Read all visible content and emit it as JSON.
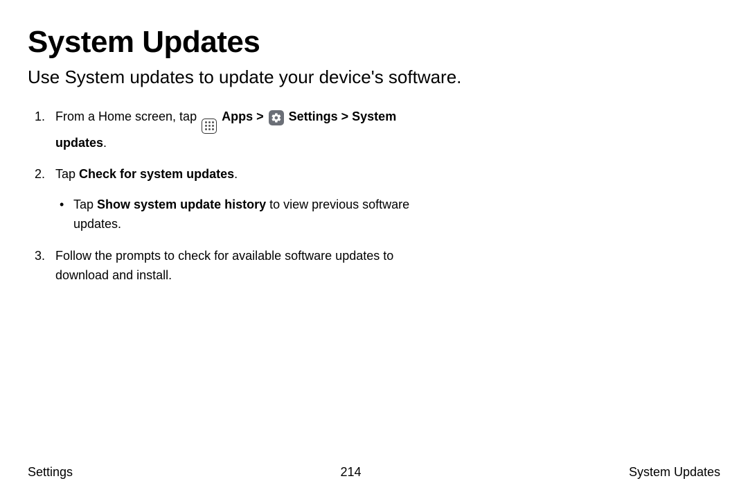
{
  "title": "System Updates",
  "subtitle": "Use System updates to update your device's software.",
  "steps": {
    "s1": {
      "part1": "From a Home screen, tap ",
      "apps": "Apps",
      "sep1": " > ",
      "settings": "Settings",
      "sep2": " > ",
      "sysupdates": "System updates",
      "end": "."
    },
    "s2": {
      "part1": "Tap ",
      "bold": "Check for system updates",
      "end": ".",
      "bullet": {
        "part1": "Tap ",
        "bold": "Show system update history",
        "part2": " to view previous software updates."
      }
    },
    "s3": "Follow the prompts to check for available software updates to download and install."
  },
  "footer": {
    "left": "Settings",
    "center": "214",
    "right": "System Updates"
  }
}
